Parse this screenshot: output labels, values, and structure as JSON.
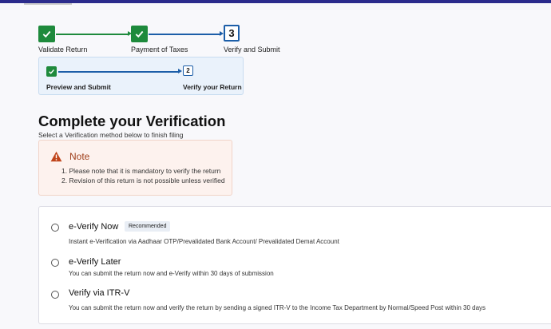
{
  "stepper": {
    "steps": [
      {
        "label": "Validate Return",
        "state": "done"
      },
      {
        "label": "Payment of Taxes",
        "state": "done"
      },
      {
        "label": "Verify and Submit",
        "state": "current",
        "number": "3"
      }
    ],
    "sub_steps": [
      {
        "label": "Preview and Submit",
        "state": "done"
      },
      {
        "label": "Verify your Return",
        "state": "current",
        "number": "2"
      }
    ]
  },
  "page": {
    "title": "Complete your Verification",
    "subtitle": "Select a Verification method below to finish filing"
  },
  "note": {
    "title": "Note",
    "items": [
      "1. Please note that it is mandatory to verify the return",
      "2. Revision of this return is not possible unless verified"
    ]
  },
  "options": [
    {
      "title": "e-Verify Now",
      "badge": "Recommended",
      "description": "Instant e-Verification via Aadhaar OTP/Prevalidated Bank Account/ Prevalidated Demat Account"
    },
    {
      "title": "e-Verify Later",
      "description": "You can submit the return now and e-Verify within 30 days of submission"
    },
    {
      "title": "Verify via ITR-V",
      "description": "You can submit the return now and verify the return by sending a signed ITR-V to the Income Tax Department by Normal/Speed Post within 30 days"
    }
  ],
  "colors": {
    "done": "#1e8a3c",
    "current": "#1c5ea8",
    "note_accent": "#a0401c"
  },
  "icons": {
    "done": "checkmark-icon",
    "note": "warning-triangle-icon"
  }
}
